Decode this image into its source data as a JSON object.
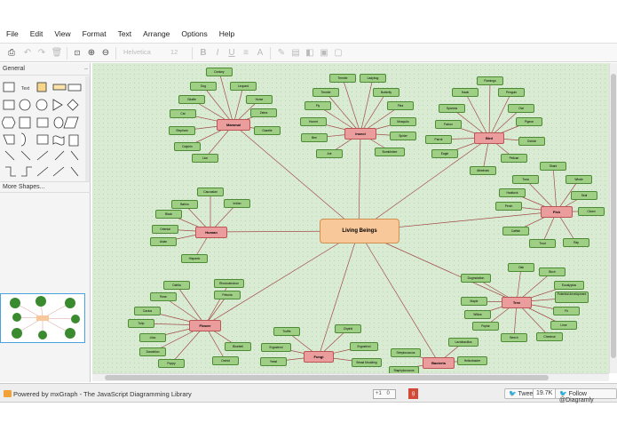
{
  "menu": [
    "File",
    "Edit",
    "View",
    "Format",
    "Text",
    "Arrange",
    "Options",
    "Help"
  ],
  "toolbar": {
    "font": "Helvetica",
    "size": "12"
  },
  "sidebar": {
    "general": "General",
    "text_shape": "Text",
    "more_shapes": "More Shapes..."
  },
  "footer": {
    "powered": "Powered by mxGraph - The JavaScript Diagramming Library",
    "gplus": "+1",
    "gplus_count": "0",
    "tweet": "Tweet",
    "tweet_count": "19.7K",
    "follow": "Follow @Diagramly"
  },
  "diagram": {
    "root": "Living Beings",
    "categories": [
      "Mammal",
      "Insect",
      "Bird",
      "Human",
      "Fish",
      "Flower",
      "Fungi",
      "Bacteria",
      "Tree"
    ],
    "mammal": [
      "Donkey",
      "Dog",
      "Leopard",
      "Giraffe",
      "Horse",
      "Cat",
      "Zebra",
      "Elephant",
      "Gazelle",
      "Dolphin",
      "Lion"
    ],
    "insect": [
      "Termite",
      "Ladybug",
      "Termite",
      "Butterfly",
      "Fly",
      "Flea",
      "Hornet",
      "Mosquito",
      "Bee",
      "Spider",
      "Ant",
      "Bumblebee"
    ],
    "bird": [
      "Flamingo",
      "Hawk",
      "Penguin",
      "Sparrow",
      "Owl",
      "Falcon",
      "Pigeon",
      "Parrot",
      "Ostrich",
      "Eagle",
      "Pelican",
      "Albatross"
    ],
    "human": [
      "Caucasian",
      "Bahnu",
      "Indian",
      "Black",
      "Oriental",
      "Asian",
      "Hispanic"
    ],
    "fish": [
      "Shark",
      "Tuna",
      "Whale",
      "Seal",
      "Haddock",
      "Perch",
      "Clown",
      "Catfish",
      "Trout",
      "Ray"
    ],
    "flower": [
      "Dahlia",
      "Rhododendron",
      "Rose",
      "Petunia",
      "Cactus",
      "Tulip",
      "Lilac",
      "Dandelion",
      "Poppy",
      "Orchid",
      "Bluebell"
    ],
    "fungi": [
      "Truffle",
      "Chytrid",
      "Ergosterol",
      "Ergosterol",
      "Yeast",
      "Bread Moulding"
    ],
    "bacteria": [
      "Lactobacillus",
      "Streptococcus",
      "Helicobacter",
      "Staphylococcus"
    ],
    "tree": [
      "Oak",
      "Birch",
      "Dogmotation",
      "Eucalyptus",
      "Potential development",
      "Maple",
      "Fir",
      "Willow",
      "Poplar",
      "Lime",
      "Beech",
      "Chestnut"
    ]
  }
}
